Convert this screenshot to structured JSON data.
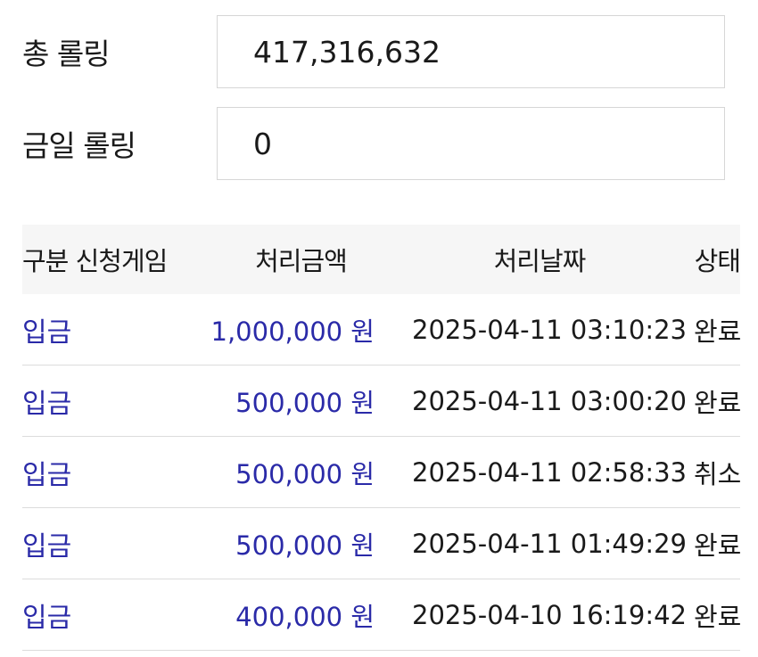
{
  "summary": {
    "total_label": "총 롤링",
    "total_value": "417,316,632",
    "today_label": "금일 롤링",
    "today_value": "0"
  },
  "table": {
    "headers": {
      "type": "구분 신청게임",
      "amount": "처리금액",
      "date": "처리날짜",
      "status": "상태"
    },
    "rows": [
      {
        "type": "입금",
        "amount": "1,000,000 원",
        "date": "2025-04-11 03:10:23",
        "status": "완료"
      },
      {
        "type": "입금",
        "amount": "500,000 원",
        "date": "2025-04-11 03:00:20",
        "status": "완료"
      },
      {
        "type": "입금",
        "amount": "500,000 원",
        "date": "2025-04-11 02:58:33",
        "status": "취소"
      },
      {
        "type": "입금",
        "amount": "500,000 원",
        "date": "2025-04-11 01:49:29",
        "status": "완료"
      },
      {
        "type": "입금",
        "amount": "400,000 원",
        "date": "2025-04-10 16:19:42",
        "status": "완료"
      }
    ]
  },
  "colors": {
    "link": "#2a2aa8",
    "text": "#1a1a1a",
    "header_bg": "#f6f6f6",
    "border": "#d6d6d6"
  }
}
